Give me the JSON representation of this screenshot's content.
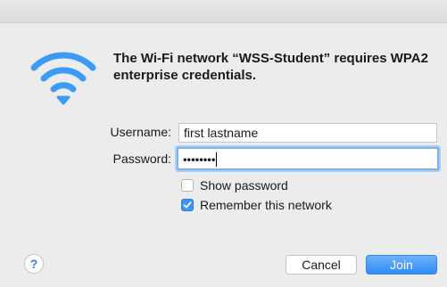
{
  "dialog": {
    "heading": "The Wi-Fi network “WSS-Student” requires WPA2 enterprise credentials.",
    "icon": "wifi-icon",
    "accent_color": "#3b93f5"
  },
  "form": {
    "username_label": "Username:",
    "username_value": "first lastname",
    "password_label": "Password:",
    "password_masked": "••••••••"
  },
  "options": {
    "show_password_label": "Show password",
    "show_password_checked": false,
    "remember_label": "Remember this network",
    "remember_checked": true
  },
  "buttons": {
    "help_label": "?",
    "cancel_label": "Cancel",
    "join_label": "Join"
  }
}
